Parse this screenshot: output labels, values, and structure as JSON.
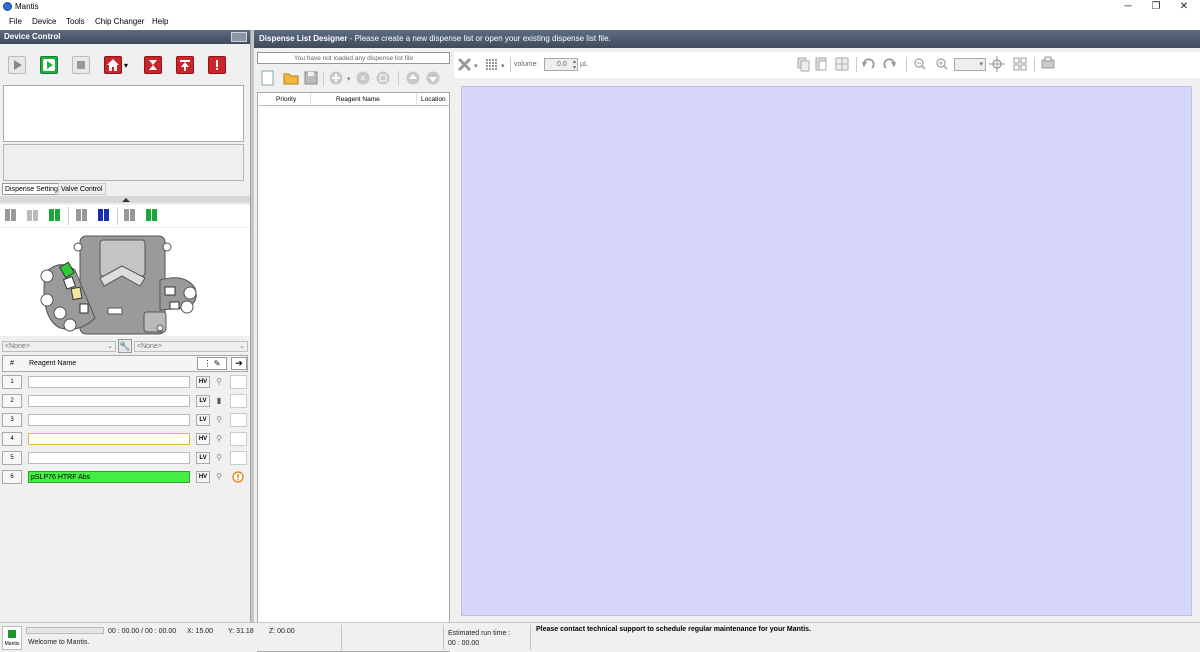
{
  "window": {
    "title": "Mantis",
    "minimize": "─",
    "restore": "❐",
    "close": "✕"
  },
  "menu": [
    "File",
    "Device",
    "Tools",
    "Chip Changer",
    "Help"
  ],
  "device_control": {
    "title": "Device Control",
    "tabs": [
      "Dispense Setting",
      "Valve Control"
    ],
    "dropdown_left": "<None>",
    "dropdown_right": "<None>",
    "table_header": {
      "num": "#",
      "name": "Reagent Name"
    },
    "rows": [
      {
        "num": "1",
        "name": "",
        "chip": "HV",
        "color": "#ffffff"
      },
      {
        "num": "2",
        "name": "",
        "chip": "LV",
        "color": "#ffffff"
      },
      {
        "num": "3",
        "name": "",
        "chip": "LV",
        "color": "#ffffff"
      },
      {
        "num": "4",
        "name": "",
        "chip": "HV",
        "color": "#ffffff"
      },
      {
        "num": "5",
        "name": "",
        "chip": "LV",
        "color": "#ffffff"
      },
      {
        "num": "6",
        "name": "pSLP76 HTRF Abs",
        "chip": "HV",
        "color": "#44ee44"
      }
    ]
  },
  "dispense_list": {
    "title": "Dispense List Designer",
    "subtitle": " - Please create a new dispense list or open your existing dispense list file.",
    "file_placeholder": "You have not loaded any dispense list file",
    "columns": [
      "Priority",
      "Reagent Name",
      "Location"
    ],
    "volume_label": "volume:",
    "volume_value": "0.0",
    "volume_unit": "µL",
    "canvas_color": "#d6d6fa"
  },
  "status": {
    "logo_label": "Mantis",
    "welcome": "Welcome to Mantis.",
    "time": "00 : 00.00 / 00 : 00.00",
    "x": "X: 15.00",
    "y": "Y: 31.18",
    "z": "Z: 00.00",
    "est_label": "Estimated run time :",
    "est_value": "00 : 00.00",
    "maintenance": "Please contact technical support to schedule regular maintenance for your Mantis."
  }
}
